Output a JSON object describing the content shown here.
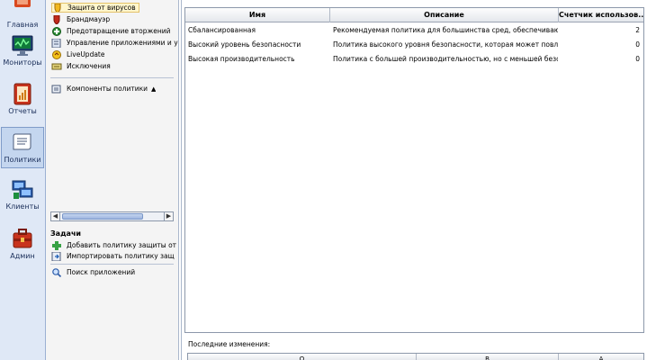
{
  "nav": {
    "items": [
      {
        "label": "Главная",
        "icon": "home-icon"
      },
      {
        "label": "Мониторы",
        "icon": "monitor-icon"
      },
      {
        "label": "Отчеты",
        "icon": "reports-icon"
      },
      {
        "label": "Политики",
        "icon": "policies-icon",
        "selected": true
      },
      {
        "label": "Клиенты",
        "icon": "clients-icon"
      },
      {
        "label": "Админ",
        "icon": "admin-icon"
      }
    ]
  },
  "policy_tree": {
    "items": [
      {
        "label": "Защита от вирусов",
        "icon": "shield-icon",
        "selected": true
      },
      {
        "label": "Брандмауэр",
        "icon": "firewall-icon"
      },
      {
        "label": "Предотвращение вторжений",
        "icon": "intrusion-icon"
      },
      {
        "label": "Управление приложениями и у",
        "icon": "app-control-icon"
      },
      {
        "label": "LiveUpdate",
        "icon": "liveupdate-icon"
      },
      {
        "label": "Исключения",
        "icon": "exceptions-icon"
      }
    ],
    "components_label": "Компоненты политики",
    "components_toggle": "▲"
  },
  "tasks": {
    "title": "Задачи",
    "items": [
      {
        "label": "Добавить политику защиты от",
        "icon": "add-icon"
      },
      {
        "label": "Импортировать политику защ",
        "icon": "import-icon"
      },
      {
        "label": "Поиск приложений",
        "icon": "search-icon"
      }
    ]
  },
  "scrollbar": {
    "left_arrow": "◀",
    "right_arrow": "▶"
  },
  "grid": {
    "columns": [
      "Имя",
      "Описание",
      "Счетчик использов..."
    ],
    "rows": [
      {
        "name": "Сбалансированная",
        "description": "Рекомендуемая политика для большинства сред, обеспечивающ...",
        "count": "2"
      },
      {
        "name": "Высокий уровень безопасности",
        "description": "Политика высокого уровня безопасности, которая может повлия...",
        "count": "0"
      },
      {
        "name": "Высокая производительность",
        "description": "Политика с большей производительностью, но с меньшей безопа...",
        "count": "0"
      }
    ]
  },
  "recent": {
    "label": "Последние изменения:",
    "columns": [
      "О",
      "В",
      "А"
    ]
  },
  "colors": {
    "accent": "#dfe8f6",
    "selected_tree": "#fff6cc",
    "grid_border": "#8c98aa"
  }
}
